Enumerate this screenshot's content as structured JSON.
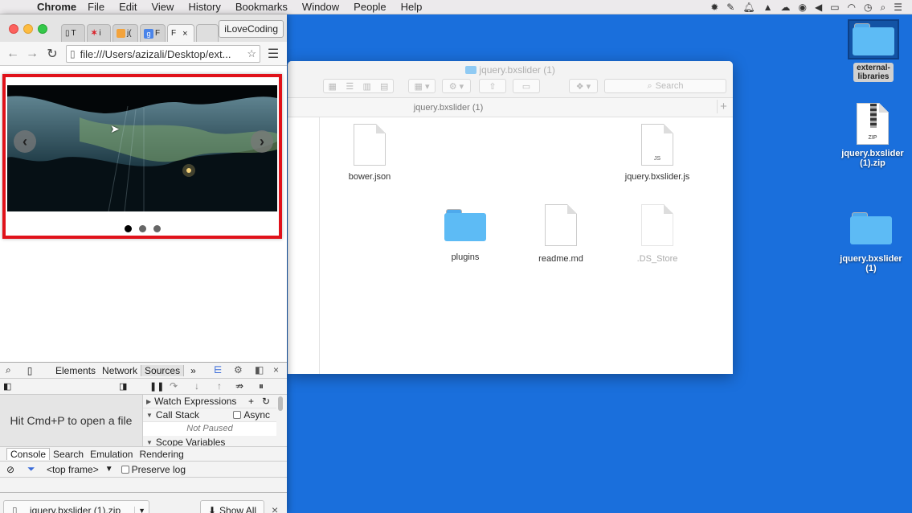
{
  "menubar": {
    "app_name": "Chrome",
    "items": [
      "File",
      "Edit",
      "View",
      "History",
      "Bookmarks",
      "Window",
      "People",
      "Help"
    ]
  },
  "desktop": {
    "icons": [
      {
        "label": "external-libraries",
        "kind": "folder",
        "selected": true
      },
      {
        "label": "jquery.bxslider (1).zip",
        "kind": "zip",
        "badge": "ZIP"
      },
      {
        "label": "jquery.bxslider (1)",
        "kind": "folder"
      }
    ],
    "colors": {
      "background": "#1a6fdc",
      "folder": "#5dbbf5"
    }
  },
  "finder": {
    "title": "jquery.bxslider (1)",
    "path_title": "jquery.bxslider (1)",
    "search_placeholder": "Search",
    "files": [
      {
        "name": "bower.json",
        "kind": "doc"
      },
      {
        "name": "jquery.bxslider.js",
        "kind": "js",
        "badge": "JS"
      },
      {
        "name": "plugins",
        "kind": "folder"
      },
      {
        "name": "readme.md",
        "kind": "doc"
      },
      {
        "name": ".DS_Store",
        "kind": "doc",
        "dimmed": true
      }
    ]
  },
  "chrome": {
    "tabs": [
      {
        "label": "T"
      },
      {
        "label": "i"
      },
      {
        "label": "j("
      },
      {
        "label": "F"
      },
      {
        "label": "F",
        "active": true
      }
    ],
    "profile_button": "iLoveCoding",
    "url": "file:///Users/azizali/Desktop/ext...",
    "slider": {
      "slide_count": 3,
      "active_slide": 1,
      "prev_label": "‹",
      "next_label": "›",
      "border_color": "#e0121a"
    }
  },
  "devtools": {
    "tabs": [
      "Elements",
      "Network",
      "Sources"
    ],
    "active_tab": "Sources",
    "overflow_label": "»",
    "nav_hint": "Hit Cmd+P to open a file",
    "debug_sections": {
      "watch": "Watch Expressions",
      "call_stack": "Call Stack",
      "async": "Async",
      "not_paused": "Not Paused",
      "scope": "Scope Variables"
    },
    "drawer_tabs": [
      "Console",
      "Search",
      "Emulation",
      "Rendering"
    ],
    "drawer_active": "Console",
    "frame_select": "<top frame>",
    "preserve_log": "Preserve log"
  },
  "downloads": {
    "file_name": "jquery.bxslider (1).zip",
    "show_all": "Show All",
    "close_icon": "×"
  }
}
